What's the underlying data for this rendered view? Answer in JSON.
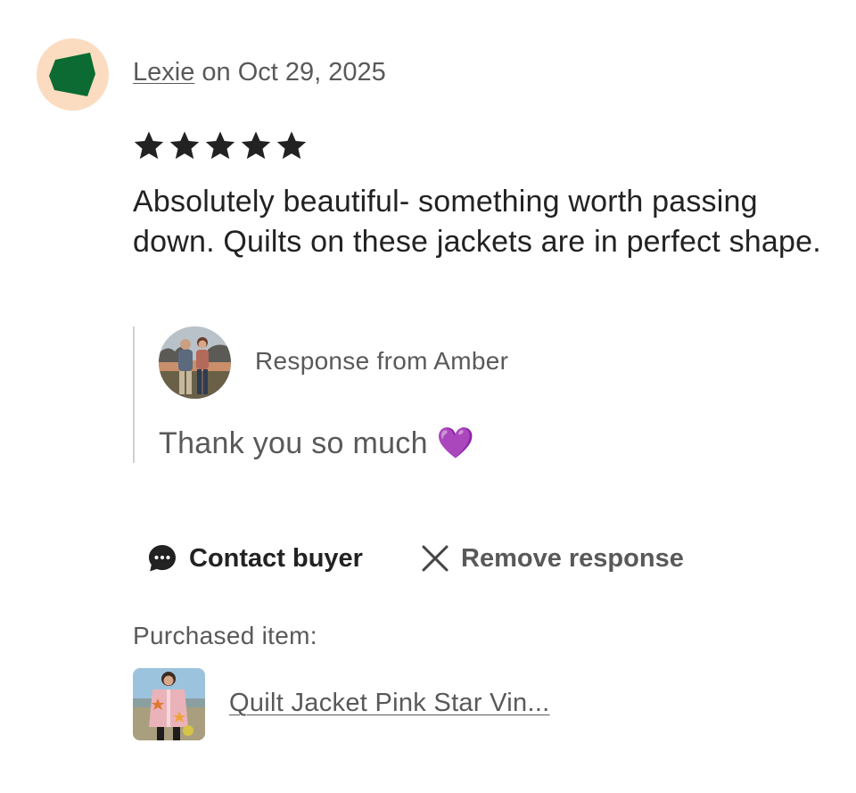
{
  "review": {
    "reviewer_name": "Lexie",
    "date_text": " on Oct 29, 2025",
    "rating": 5,
    "max_rating": 5,
    "text": "Absolutely beautiful- something worth passing down. Quilts on these jackets are in perfect shape."
  },
  "response": {
    "from_label": "Response from Amber",
    "text": "Thank you so much 💜"
  },
  "actions": {
    "contact_label": "Contact buyer",
    "remove_label": "Remove response"
  },
  "purchase": {
    "label": "Purchased item:",
    "item_title": "Quilt Jacket Pink Star Vin..."
  },
  "colors": {
    "avatar_bg": "#fbdcc0",
    "avatar_shape": "#0b6b32",
    "text_primary": "#222222",
    "text_secondary": "#595959",
    "divider": "#d0d0d0"
  }
}
